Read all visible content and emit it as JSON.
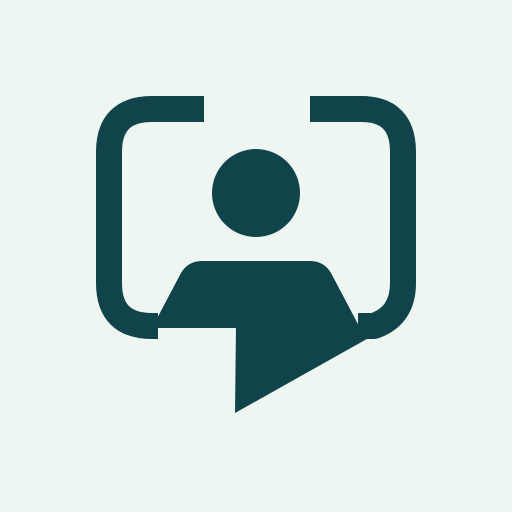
{
  "app_icon": {
    "name": "profile-chat-logo",
    "icon": "person-in-speech-bubble-icon",
    "colors": {
      "background": "#EEF6F2",
      "foreground": "#10434A"
    }
  }
}
